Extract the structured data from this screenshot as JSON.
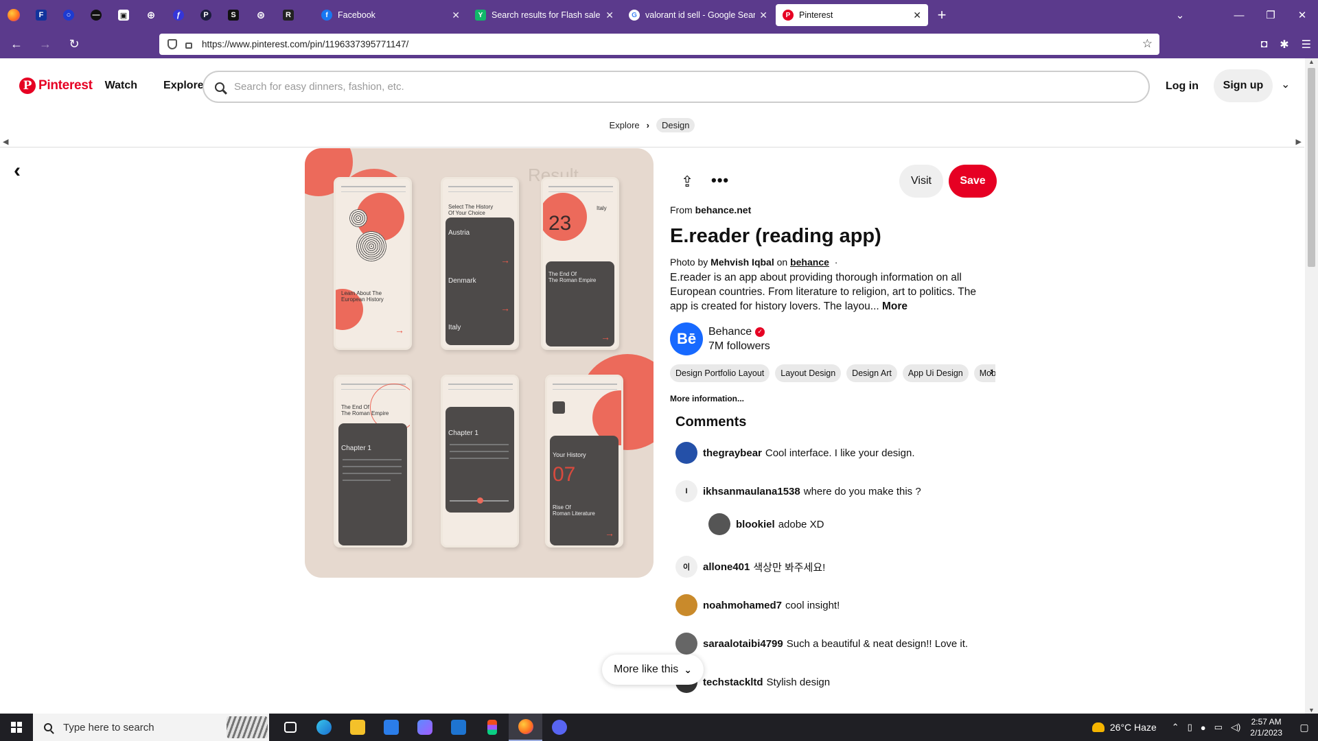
{
  "browser": {
    "tabs": [
      {
        "label": "Facebook",
        "color": "#1877f2",
        "glyph": "f"
      },
      {
        "label": "Search results for Flash sale - Fl",
        "color": "#12b76a",
        "glyph": "Y"
      },
      {
        "label": "valorant id sell - Google Search",
        "color": "#4285f4",
        "glyph": "G"
      },
      {
        "label": "Pinterest",
        "color": "#e60023",
        "glyph": "P"
      }
    ],
    "new_tab": "+",
    "url": "https://www.pinterest.com/pin/1196337395771147/"
  },
  "header": {
    "logo_text": "Pinterest",
    "nav": [
      "Watch",
      "Explore"
    ],
    "search_placeholder": "Search for easy dinners, fashion, etc.",
    "login": "Log in",
    "signup": "Sign up"
  },
  "breadcrumb": {
    "items": [
      "Explore",
      "Design"
    ],
    "separator": "›"
  },
  "pin_image": {
    "result_label": "Result",
    "phones": [
      {
        "title": "Learn About The\nEuropean History"
      },
      {
        "title": "Select The History\nOf Your Choice",
        "items": [
          "Austria",
          "Denmark",
          "Italy"
        ]
      },
      {
        "title": "Italy",
        "big": "23",
        "sub": "The End Of\nThe Roman Empire"
      },
      {
        "title": "The End Of\nThe Roman Empire",
        "sub": "Chapter 1"
      },
      {
        "title": "Chapter 1"
      },
      {
        "title": "Your History",
        "big": "07",
        "sub": "Rise Of\nRoman Literature"
      }
    ]
  },
  "pin": {
    "visit": "Visit",
    "save": "Save",
    "from_prefix": "From",
    "from_site": "behance.net",
    "title": "E.reader (reading app)",
    "photo_prefix": "Photo by",
    "photographer": "Mehvish Iqbal",
    "on_word": "on",
    "on_site": "behance",
    "byline_dot": "·",
    "description": "E.reader is an app about providing thorough information on all European countries. From literature to religion, art to politics. The app is created for history lovers. The layou...",
    "more": "More",
    "creator": {
      "name": "Behance",
      "logo": "Bē",
      "followers": "7M followers"
    },
    "tags": [
      "Design Portfolio Layout",
      "Layout Design",
      "Design Art",
      "App Ui Design",
      "Mobile"
    ],
    "more_information": "More information..."
  },
  "comments": {
    "heading": "Comments",
    "items": [
      {
        "user": "thegraybear",
        "text": "Cool interface. I like your design.",
        "avatar_color": "#2450a8",
        "initial": ""
      },
      {
        "user": "ikhsanmaulana1538",
        "text": "where do you make this ?",
        "avatar_color": "#efefef",
        "initial": "I"
      },
      {
        "user": "blookiel",
        "text": "adobe XD",
        "avatar_color": "#555555",
        "initial": ""
      },
      {
        "user": "allone401",
        "text": "색상만 봐주세요!",
        "avatar_color": "#efefef",
        "initial": "이"
      },
      {
        "user": "noahmohamed7",
        "text": "cool insight!",
        "avatar_color": "#c98a2b",
        "initial": ""
      },
      {
        "user": "saraalotaibi4799",
        "text": "Such a beautiful & neat design!! Love it.",
        "avatar_color": "#666666",
        "initial": ""
      },
      {
        "user": "techstackltd",
        "text": "Stylish design",
        "avatar_color": "#333333",
        "initial": ""
      }
    ]
  },
  "more_like_this": "More like this",
  "taskbar": {
    "search_placeholder": "Type here to search",
    "weather": "26°C  Haze",
    "time": "2:57 AM",
    "date": "2/1/2023"
  }
}
